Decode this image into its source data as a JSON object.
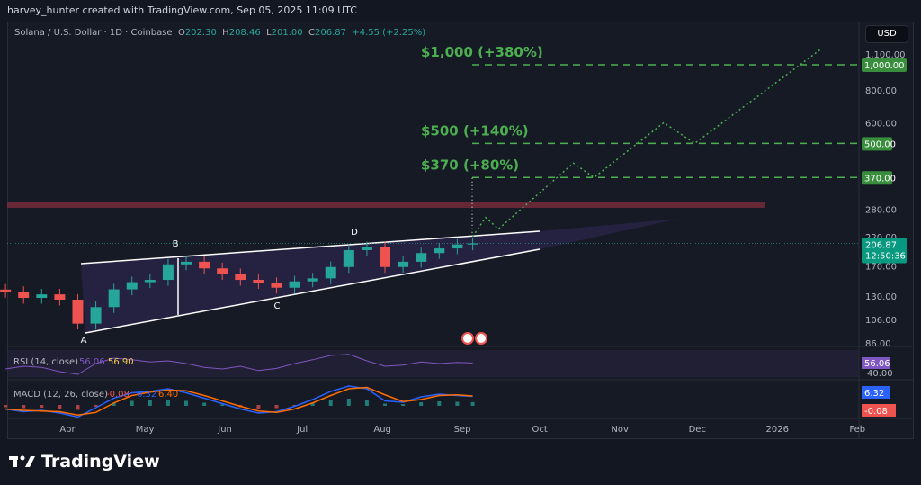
{
  "header": "harvey_hunter created with TradingView.com, Sep 05, 2025 11:09 UTC",
  "legend": {
    "symbol": "Solana / U.S. Dollar · 1D · Coinbase",
    "o_label": "O",
    "o": "202.30",
    "h_label": "H",
    "h": "208.46",
    "l_label": "L",
    "l": "201.00",
    "c_label": "C",
    "c": "206.87",
    "change": "+4.55 (+2.25%)"
  },
  "currency": "USD",
  "footer": {
    "logo": "TradingView"
  },
  "colors": {
    "up": "#26a69a",
    "down": "#ef5350",
    "target": "#4caf50",
    "wedge": "#ffffff",
    "rsi": "#7e57c2",
    "rsi_ma": "#f2c94c",
    "macd": "#2962ff",
    "signal": "#ff6d00"
  },
  "chart_data": {
    "type": "candlestick",
    "scale": "log",
    "ylim": [
      86,
      1100
    ],
    "y_ticks": [
      "1,100.00",
      "800.00",
      "600.00",
      "280.00",
      "220.00",
      "170.00",
      "130.00",
      "106.00",
      "86.00"
    ],
    "x_ticks": [
      "Apr",
      "May",
      "Jun",
      "Jul",
      "Aug",
      "Sep",
      "Oct",
      "Nov",
      "Dec",
      "2026",
      "Feb"
    ],
    "weekly_closes": {
      "dates": [
        "2025-03-08",
        "2025-03-15",
        "2025-03-22",
        "2025-03-29",
        "2025-04-05",
        "2025-04-12",
        "2025-04-19",
        "2025-04-26",
        "2025-05-03",
        "2025-05-10",
        "2025-05-17",
        "2025-05-24",
        "2025-05-31",
        "2025-06-07",
        "2025-06-14",
        "2025-06-21",
        "2025-06-28",
        "2025-07-05",
        "2025-07-12",
        "2025-07-19",
        "2025-07-26",
        "2025-08-02",
        "2025-08-09",
        "2025-08-16",
        "2025-08-23",
        "2025-08-30",
        "2025-09-05"
      ],
      "values": [
        135,
        128,
        132,
        126,
        102,
        118,
        138,
        147,
        150,
        172,
        176,
        166,
        158,
        150,
        146,
        140,
        148,
        152,
        168,
        195,
        200,
        168,
        176,
        190,
        198,
        205,
        207
      ]
    },
    "price_labels": [
      {
        "text": "1,000.00",
        "value": 1000
      },
      {
        "text": "500.00",
        "value": 500
      },
      {
        "text": "370.00",
        "value": 370
      }
    ],
    "last_price": {
      "value": "206.87",
      "countdown": "12:50:36"
    },
    "targets": [
      {
        "label": "$1,000 (+380%)",
        "value": 1000
      },
      {
        "label": "$500 (+140%)",
        "value": 500
      },
      {
        "label": "$370 (+80%)",
        "value": 370
      }
    ],
    "pattern_points": [
      {
        "label": "A",
        "date": "2025-04-07",
        "value": 95
      },
      {
        "label": "B",
        "date": "2025-05-14",
        "value": 186
      },
      {
        "label": "C",
        "date": "2025-06-22",
        "value": 128
      },
      {
        "label": "D",
        "date": "2025-07-22",
        "value": 206
      }
    ],
    "resistance_zone": 290,
    "projection_path": [
      {
        "date": "2025-09-05",
        "value": 220
      },
      {
        "date": "2025-09-10",
        "value": 260
      },
      {
        "date": "2025-09-15",
        "value": 235
      },
      {
        "date": "2025-10-14",
        "value": 420
      },
      {
        "date": "2025-10-22",
        "value": 370
      },
      {
        "date": "2025-11-18",
        "value": 600
      },
      {
        "date": "2025-11-30",
        "value": 500
      },
      {
        "date": "2026-01-18",
        "value": 1150
      }
    ],
    "rsi": {
      "label": "RSI (14, close)",
      "value": "56.06",
      "ma": "56.90",
      "ticks": [
        "40.00"
      ],
      "values": [
        45,
        50,
        48,
        40,
        35,
        55,
        65,
        62,
        58,
        60,
        55,
        48,
        45,
        50,
        42,
        46,
        55,
        62,
        70,
        72,
        60,
        50,
        52,
        58,
        55,
        57,
        56
      ]
    },
    "macd": {
      "label": "MACD (12, 26, close)",
      "hist": "-0.08",
      "macd": "6.32",
      "signal": "6.40",
      "signal_tag": "6.40",
      "values": [
        -3,
        -5,
        -4,
        -6,
        -9,
        -2,
        5,
        9,
        10,
        12,
        9,
        5,
        1,
        -3,
        -6,
        -5,
        -1,
        4,
        10,
        14,
        12,
        3,
        2,
        6,
        8,
        7,
        6.3
      ]
    }
  }
}
